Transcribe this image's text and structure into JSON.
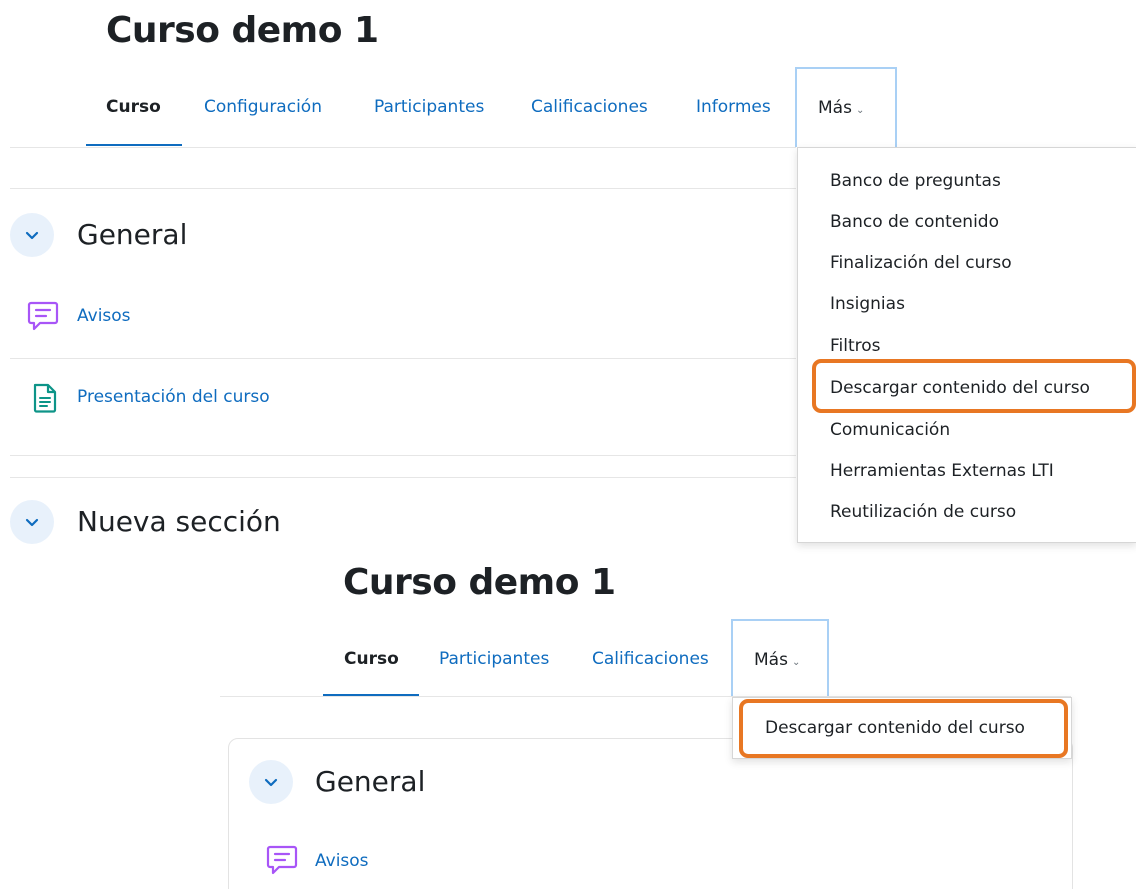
{
  "top": {
    "title": "Curso demo 1",
    "tabs": [
      {
        "label": "Curso"
      },
      {
        "label": "Configuración"
      },
      {
        "label": "Participantes"
      },
      {
        "label": "Calificaciones"
      },
      {
        "label": "Informes"
      }
    ],
    "more_label": "Más",
    "dropdown": [
      "Banco de preguntas",
      "Banco de contenido",
      "Finalización del curso",
      "Insignias",
      "Filtros",
      "Descargar contenido del curso",
      "Comunicación",
      "Herramientas Externas LTI",
      "Reutilización de curso"
    ],
    "highlighted_index": 5,
    "sections": [
      {
        "title": "General",
        "activities": [
          {
            "icon": "forum-icon",
            "label": "Avisos"
          },
          {
            "icon": "page-icon",
            "label": "Presentación del curso"
          }
        ]
      },
      {
        "title": "Nueva sección"
      }
    ]
  },
  "bottom": {
    "title": "Curso demo 1",
    "tabs": [
      {
        "label": "Curso"
      },
      {
        "label": "Participantes"
      },
      {
        "label": "Calificaciones"
      }
    ],
    "more_label": "Más",
    "dropdown": [
      "Descargar contenido del curso"
    ],
    "sections": [
      {
        "title": "General",
        "activities": [
          {
            "icon": "forum-icon",
            "label": "Avisos"
          }
        ]
      }
    ]
  },
  "colors": {
    "link": "#0f6cbf",
    "highlight": "#e87723",
    "forum_icon": "#a855f7",
    "page_icon": "#0d9488",
    "toggle_bg": "#e8f1fb"
  }
}
